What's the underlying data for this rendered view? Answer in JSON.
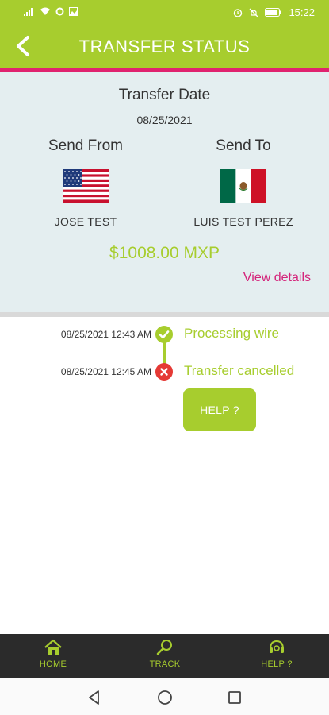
{
  "status_bar": {
    "time": "15:22"
  },
  "header": {
    "title": "TRANSFER STATUS"
  },
  "summary": {
    "date_label": "Transfer Date",
    "date_value": "08/25/2021",
    "from_label": "Send From",
    "to_label": "Send To",
    "from_name": "JOSE TEST",
    "to_name": "LUIS TEST PEREZ",
    "amount": "$1008.00 MXP",
    "view_details": "View details"
  },
  "timeline": [
    {
      "time": "08/25/2021 12:43 AM",
      "status": "Processing wire",
      "state": "done"
    },
    {
      "time": "08/25/2021 12:45 AM",
      "status": "Transfer cancelled",
      "state": "cancelled"
    }
  ],
  "help_button": "HELP ?",
  "bottom_nav": {
    "home": "HOME",
    "track": "TRACK",
    "help": "HELP ?"
  },
  "colors": {
    "brand_green": "#a7cd2e",
    "accent_pink": "#e0236f",
    "link_magenta": "#d4237a",
    "error_red": "#e53935",
    "nav_dark": "#2b2b2b"
  },
  "icons": [
    "signal-icon",
    "wifi-icon",
    "alarm-icon",
    "mute-icon",
    "battery-icon",
    "back-chevron-icon",
    "usa-flag-icon",
    "mexico-flag-icon",
    "check-icon",
    "cross-icon",
    "home-icon",
    "search-icon",
    "headset-icon"
  ]
}
